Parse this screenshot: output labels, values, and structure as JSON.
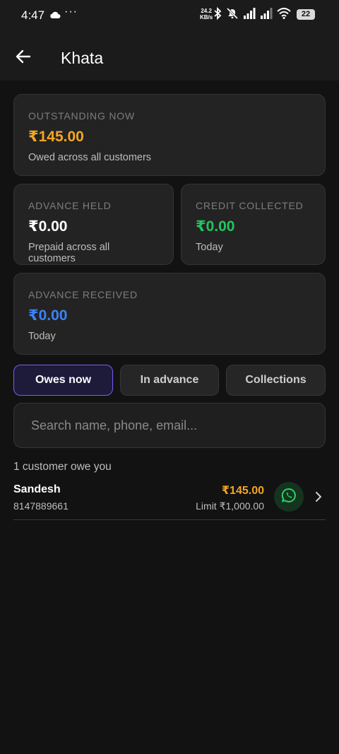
{
  "status_bar": {
    "time": "4:47",
    "speed_value": "24.2",
    "speed_unit": "KB/s",
    "battery": "22"
  },
  "app_bar": {
    "title": "Khata"
  },
  "cards": {
    "outstanding": {
      "label": "OUTSTANDING NOW",
      "value": "₹145.00",
      "sub": "Owed across all customers",
      "color": "#f5a623"
    },
    "advance_held": {
      "label": "ADVANCE HELD",
      "value": "₹0.00",
      "sub": "Prepaid across all customers",
      "color": "#ffffff"
    },
    "credit_collected": {
      "label": "CREDIT COLLECTED",
      "value": "₹0.00",
      "sub": "Today",
      "color": "#22c55e"
    },
    "advance_received": {
      "label": "ADVANCE RECEIVED",
      "value": "₹0.00",
      "sub": "Today",
      "color": "#3b82f6"
    }
  },
  "tabs": [
    {
      "label": "Owes now",
      "active": true
    },
    {
      "label": "In advance",
      "active": false
    },
    {
      "label": "Collections",
      "active": false
    }
  ],
  "search": {
    "placeholder": "Search name, phone, email..."
  },
  "list": {
    "count_text": "1 customer owe you",
    "customers": [
      {
        "name": "Sandesh",
        "phone": "8147889661",
        "amount": "₹145.00",
        "limit": "Limit ₹1,000.00"
      }
    ]
  },
  "colors": {
    "accent": "#7c5cf2",
    "owed": "#f5a623",
    "whatsapp": "#25d366",
    "background": "#121212"
  }
}
